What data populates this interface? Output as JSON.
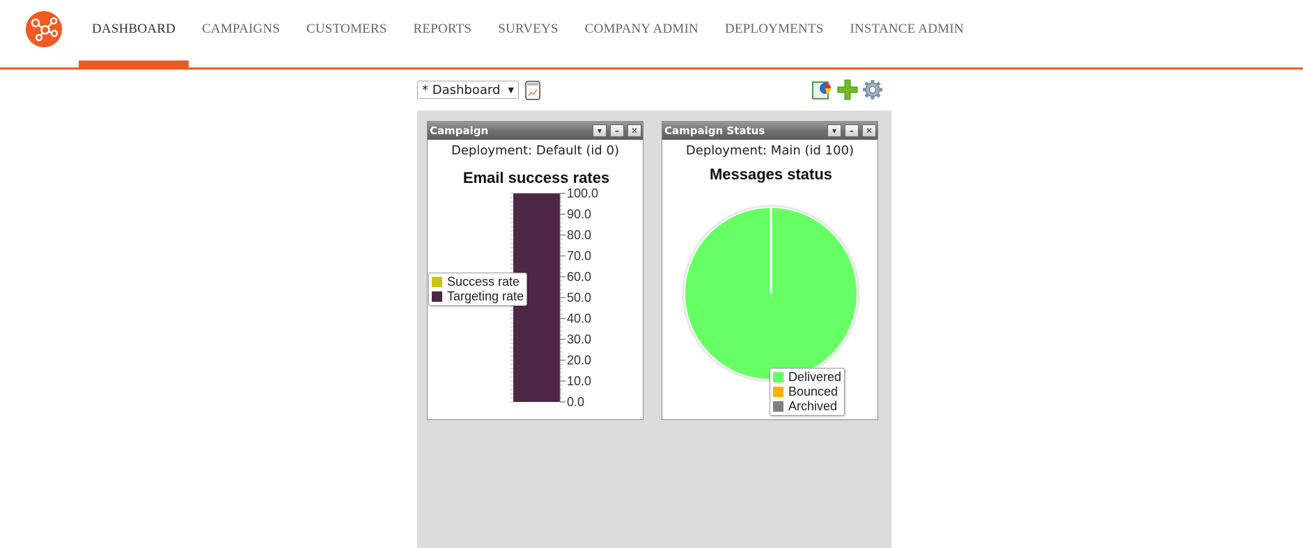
{
  "nav": {
    "items": [
      {
        "label": "DASHBOARD",
        "active": true
      },
      {
        "label": "CAMPAIGNS",
        "active": false
      },
      {
        "label": "CUSTOMERS",
        "active": false
      },
      {
        "label": "REPORTS",
        "active": false
      },
      {
        "label": "SURVEYS",
        "active": false
      },
      {
        "label": "COMPANY ADMIN",
        "active": false
      },
      {
        "label": "DEPLOYMENTS",
        "active": false
      },
      {
        "label": "INSTANCE ADMIN",
        "active": false
      }
    ]
  },
  "toolbar": {
    "dashboard_select": "* Dashboard",
    "icons": [
      "report-icon",
      "chart-widget-icon",
      "add-icon",
      "settings-gear-icon"
    ]
  },
  "colors": {
    "brand": "#f15a22",
    "success": "#c8c812",
    "targeting": "#4f2746",
    "delivered": "#66ff66",
    "bounced": "#ffb000",
    "archived": "#808080"
  },
  "widgets": [
    {
      "title": "Campaign",
      "deployment": "Deployment: Default (id 0)",
      "chart_data": {
        "type": "bar",
        "title": "Email success rates",
        "categories": [
          ""
        ],
        "series": [
          {
            "name": "Success rate",
            "values": [
              0
            ]
          },
          {
            "name": "Targeting rate",
            "values": [
              100
            ]
          }
        ],
        "ylim": [
          0,
          100
        ],
        "yticks": [
          "0.0",
          "10.0",
          "20.0",
          "30.0",
          "40.0",
          "50.0",
          "60.0",
          "70.0",
          "80.0",
          "90.0",
          "100.0"
        ],
        "axis_position": "right",
        "legend": "left"
      }
    },
    {
      "title": "Campaign Status",
      "deployment": "Deployment: Main (id 100)",
      "chart_data": {
        "type": "pie",
        "title": "Messages status",
        "labels": [
          "Delivered",
          "Bounced",
          "Archived"
        ],
        "values": [
          100,
          0,
          0
        ],
        "legend": "bottom-right"
      }
    }
  ]
}
